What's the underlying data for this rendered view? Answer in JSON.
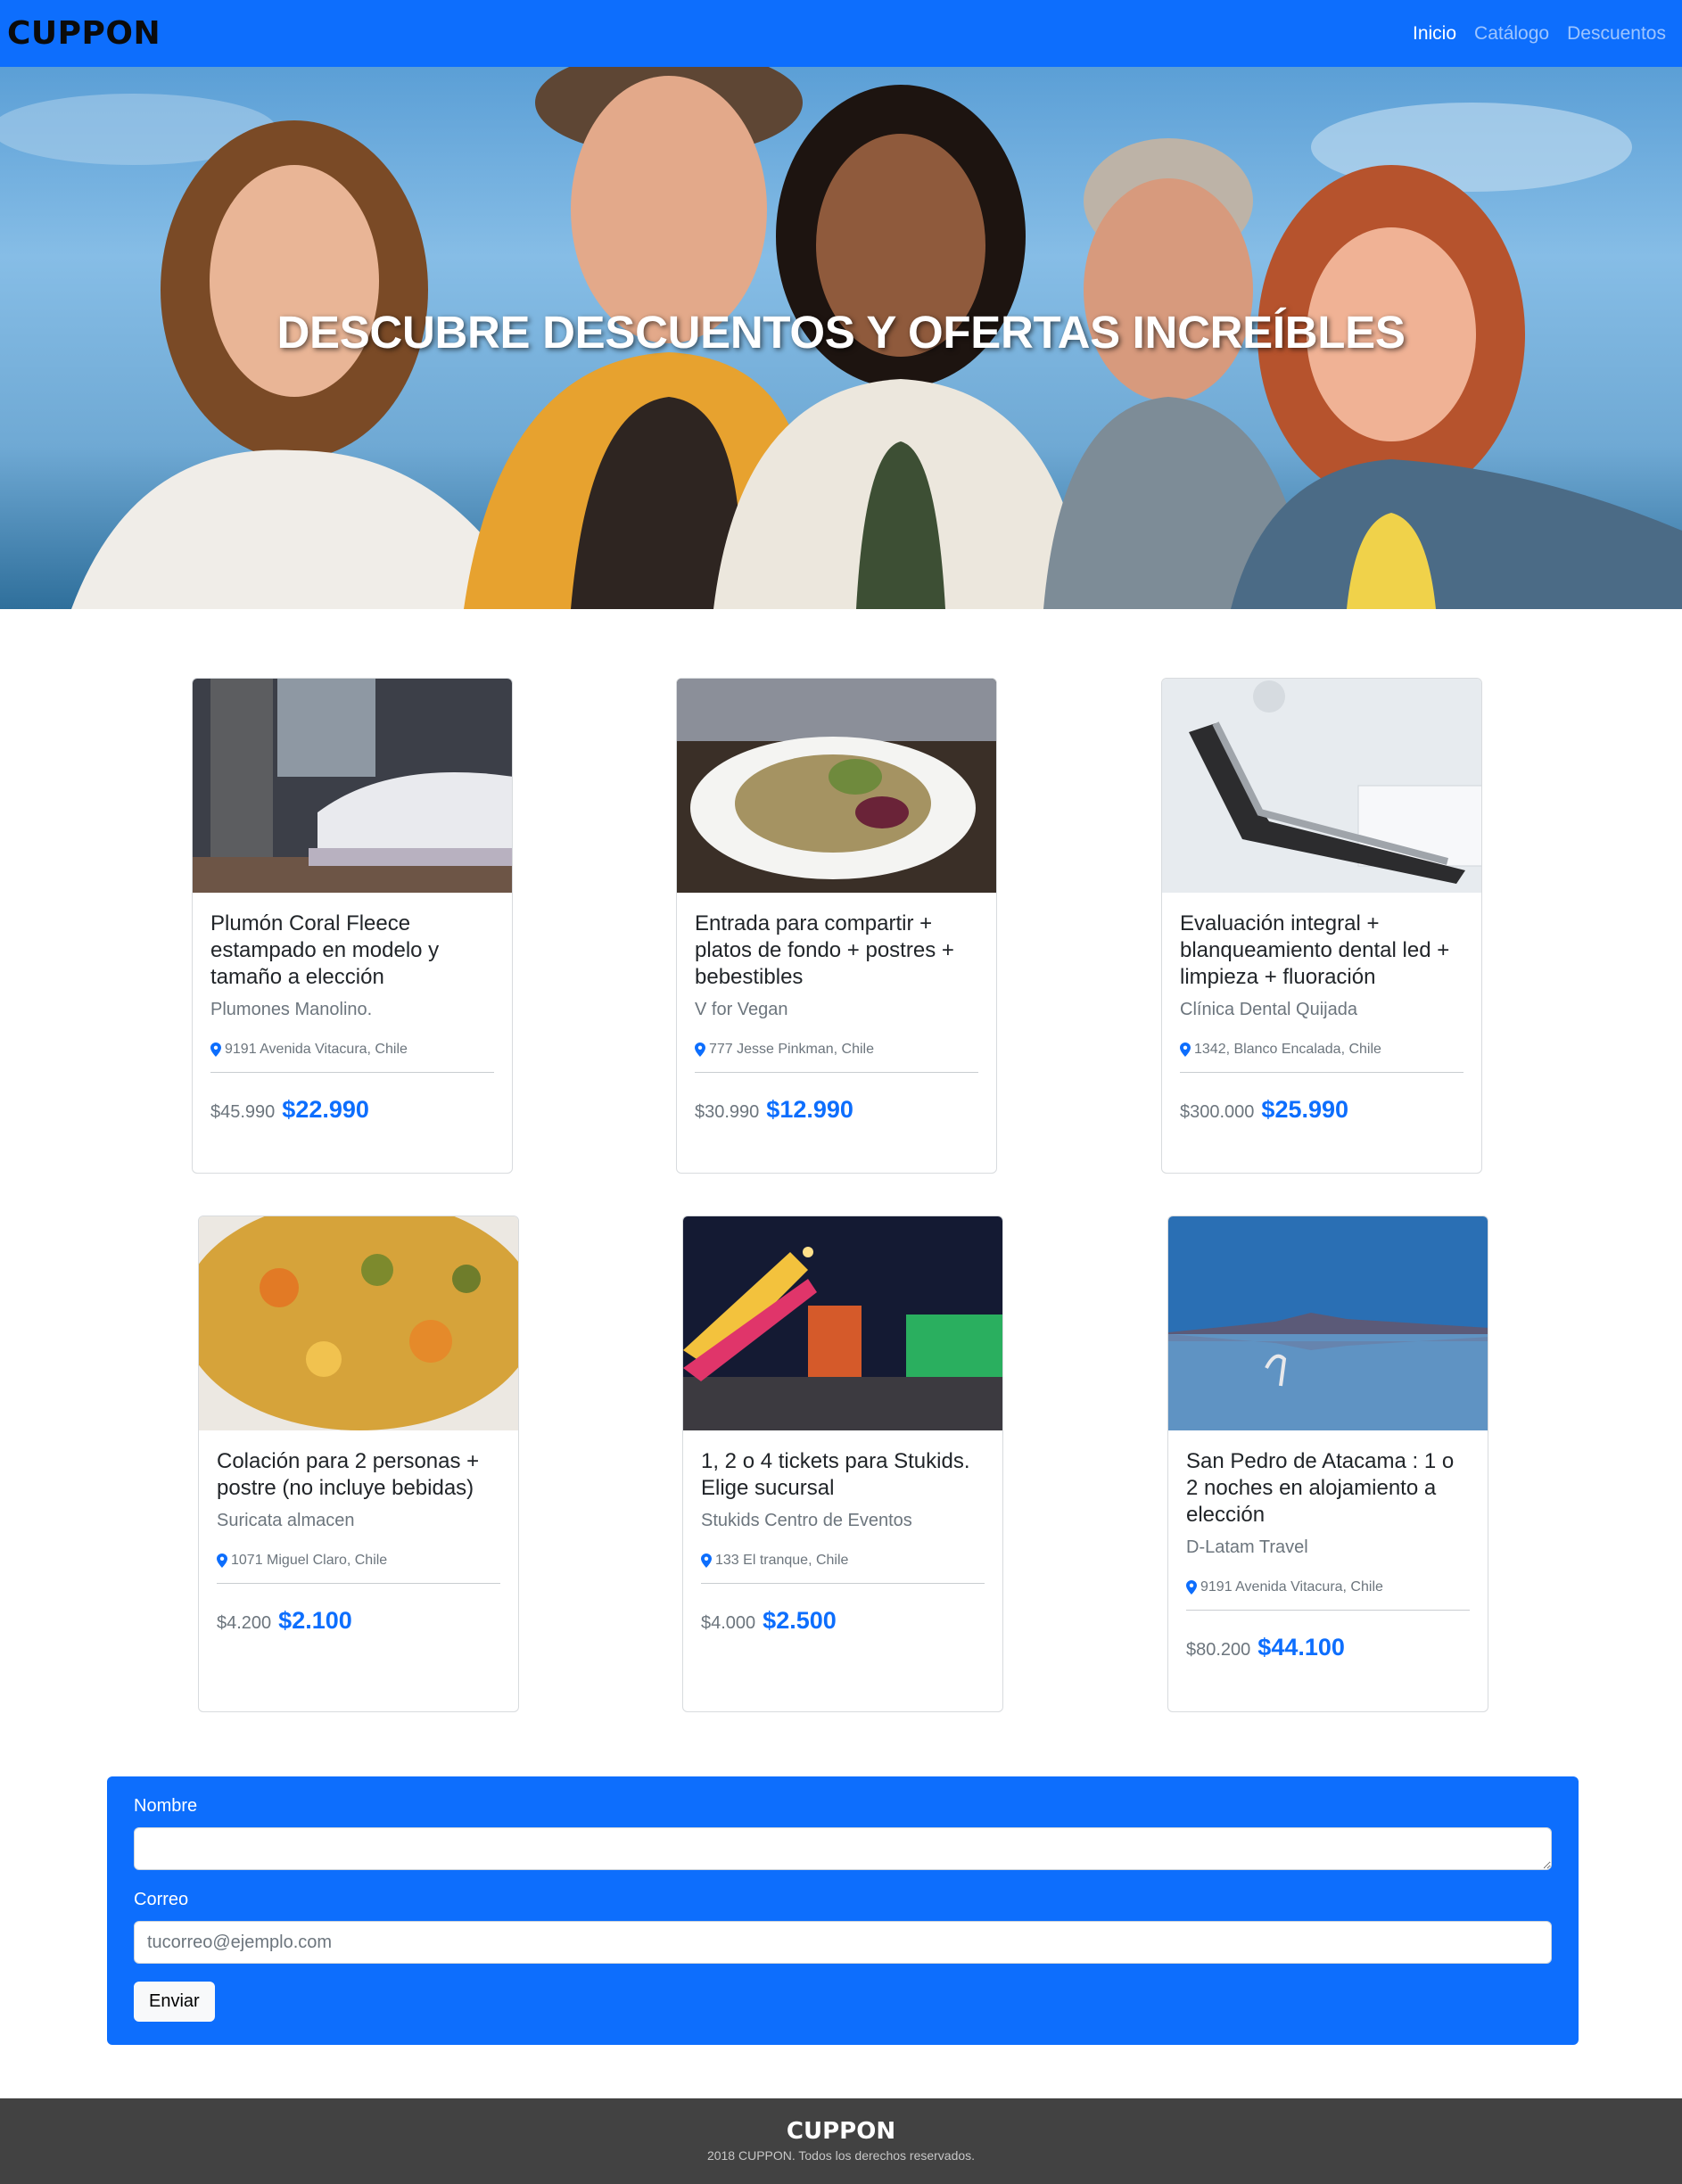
{
  "navbar": {
    "brand": "CUPPON",
    "links": [
      {
        "label": "Inicio",
        "active": true
      },
      {
        "label": "Catálogo",
        "active": false
      },
      {
        "label": "Descuentos",
        "active": false
      }
    ]
  },
  "hero": {
    "title": "DESCUBRE DESCUENTOS Y OFERTAS INCREÍBLES"
  },
  "cards": [
    {
      "title": "Plumón Coral Fleece estampado en modelo y tamaño a elección",
      "vendor": "Plumones Manolino.",
      "location": "9191 Avenida Vitacura, Chile",
      "old_price": "$45.990",
      "new_price": "$22.990",
      "image": "bedroom-photo"
    },
    {
      "title": "Entrada para compartir + platos de fondo + postres + bebestibles",
      "vendor": "V for Vegan",
      "location": "777 Jesse Pinkman, Chile",
      "old_price": "$30.990",
      "new_price": "$12.990",
      "image": "salad-photo"
    },
    {
      "title": "Evaluación integral + blanqueamiento dental led + limpieza + fluoración",
      "vendor": "Clínica Dental Quijada",
      "location": "1342, Blanco Encalada, Chile",
      "old_price": "$300.000",
      "new_price": "$25.990",
      "image": "dental-chair-photo"
    },
    {
      "title": "Colación para 2 personas + postre (no incluye bebidas)",
      "vendor": "Suricata almacen",
      "location": "1071 Miguel Claro, Chile",
      "old_price": "$4.200",
      "new_price": "$2.100",
      "image": "stew-photo"
    },
    {
      "title": "1, 2 o 4 tickets para Stukids. Elige sucursal",
      "vendor": "Stukids Centro de Eventos",
      "location": "133 El tranque, Chile",
      "old_price": "$4.000",
      "new_price": "$2.500",
      "image": "fair-rides-photo"
    },
    {
      "title": "San Pedro de Atacama : 1 o 2 noches en alojamiento a elección",
      "vendor": "D-Latam Travel",
      "location": "9191 Avenida Vitacura, Chile",
      "old_price": "$80.200",
      "new_price": "$44.100",
      "image": "salt-flat-flamingo-photo"
    }
  ],
  "form": {
    "name_label": "Nombre",
    "name_value": "",
    "email_label": "Correo",
    "email_placeholder": "tucorreo@ejemplo.com",
    "submit_label": "Enviar"
  },
  "footer": {
    "brand": "CUPPON",
    "copyright": "2018 CUPPON. Todos los derechos reservados."
  },
  "colors": {
    "primary": "#0d6efd",
    "footer_bg": "#424242",
    "muted": "#6c757d"
  }
}
